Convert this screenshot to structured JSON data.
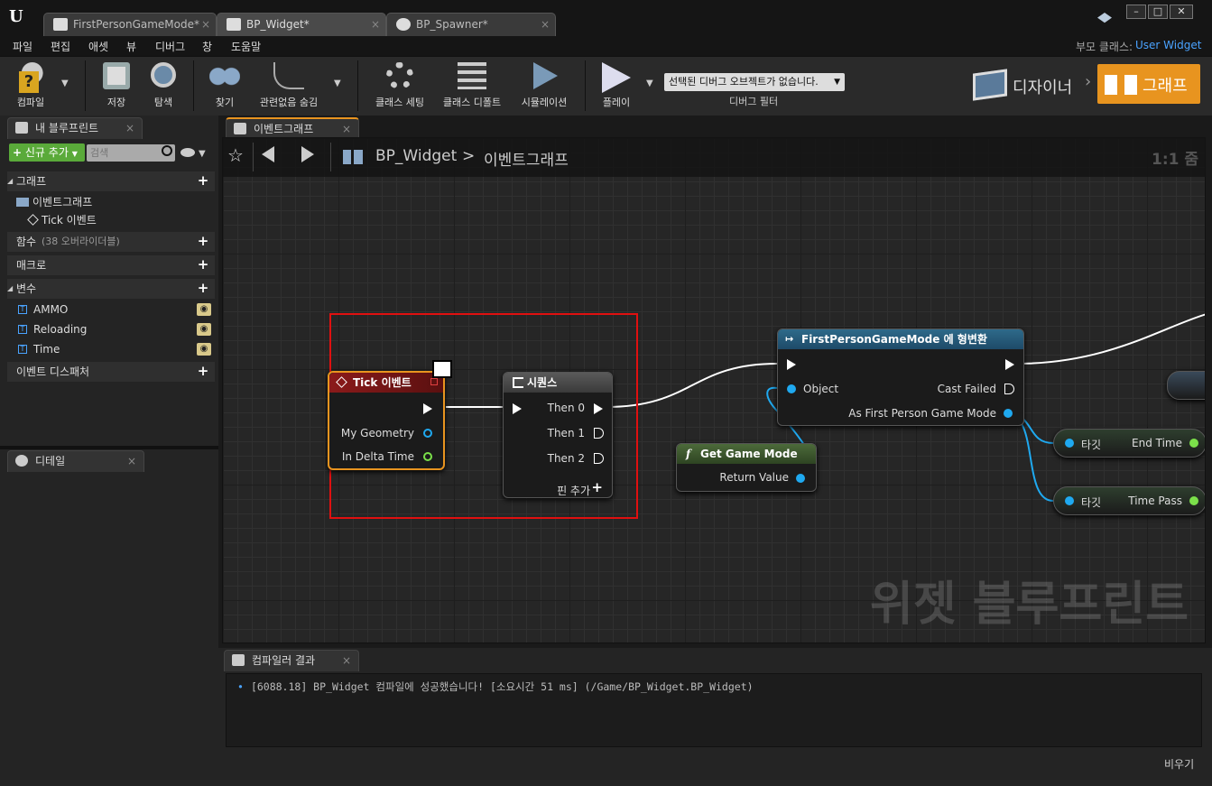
{
  "tabs": [
    {
      "label": "FirstPersonGameMode*"
    },
    {
      "label": "BP_Widget*"
    },
    {
      "label": "BP_Spawner*"
    }
  ],
  "menu": [
    "파일",
    "편집",
    "애셋",
    "뷰",
    "디버그",
    "창",
    "도움말"
  ],
  "parent_class": {
    "label": "부모 클래스:",
    "value": "User Widget"
  },
  "toolbar": {
    "compile": "컴파일",
    "save": "저장",
    "browse": "탐색",
    "find": "찾기",
    "hide_unrelated": "관련없음 숨김",
    "class_settings": "클래스 세팅",
    "class_defaults": "클래스 디폴트",
    "simulation": "시뮬레이션",
    "play": "플레이",
    "debug_select": "선택된 디버그 오브젝트가 없습니다.",
    "debug_filter": "디버그 필터",
    "designer": "디자이너",
    "graph": "그래프"
  },
  "my_blueprint": {
    "tab": "내 블루프린트",
    "add_new": "신규 추가",
    "search_placeholder": "검색",
    "graphs": "그래프",
    "event_graph": "이벤트그래프",
    "tick_event": "Tick 이벤트",
    "functions": "함수",
    "functions_count": "(38 오버라이더블)",
    "macros": "매크로",
    "variables": "변수",
    "vars": [
      "AMMO",
      "Reloading",
      "Time"
    ],
    "event_dispatchers": "이벤트 디스패처"
  },
  "details": {
    "tab": "디테일"
  },
  "graph": {
    "tab": "이벤트그래프",
    "breadcrumb_root": "BP_Widget",
    "breadcrumb_sep": ">",
    "breadcrumb_leaf": "이벤트그래프",
    "zoom": "1:1 줌",
    "watermark": "위젯 블루프린트"
  },
  "nodes": {
    "tick": {
      "title": "Tick 이벤트",
      "pins": [
        "My Geometry",
        "In Delta Time"
      ]
    },
    "sequence": {
      "title": "시퀀스",
      "pins": [
        "Then 0",
        "Then 1",
        "Then 2"
      ],
      "add_pin": "핀 추가"
    },
    "cast": {
      "title": "FirstPersonGameMode 에 형변환",
      "object": "Object",
      "cast_failed": "Cast Failed",
      "as_mode": "As First Person Game Mode"
    },
    "get_game_mode": {
      "title": "Get Game Mode",
      "return": "Return Value"
    },
    "target1": {
      "target": "타깃",
      "out": "End Time"
    },
    "target2": {
      "target": "타깃",
      "out": "Time Pass"
    }
  },
  "compiler": {
    "tab": "컴파일러 결과",
    "log": "[6088.18] BP_Widget 컴파일에 성공했습니다! [소요시간 51 ms] (/Game/BP_Widget.BP_Widget)",
    "clear": "비우기"
  },
  "colors": {
    "accent_orange": "#e8941f",
    "exec_red": "#8b1a1a",
    "func_green": "#4c6a3a",
    "highlight_red": "#e01010",
    "pin_blue": "#1fa9f0",
    "pin_green": "#7be04a"
  }
}
